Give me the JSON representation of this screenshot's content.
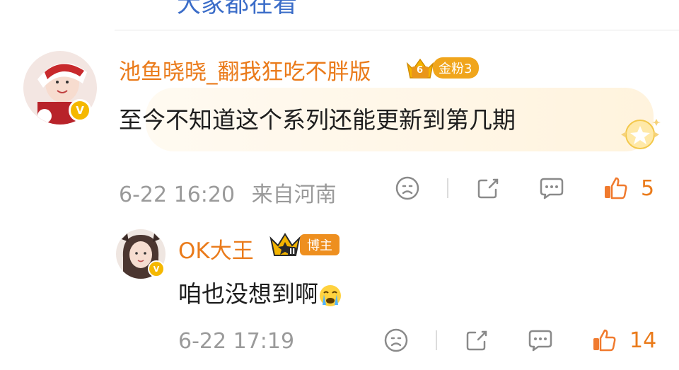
{
  "top_fragment": "大家都在看",
  "colors": {
    "accent": "#ea7b1b",
    "gold": "#f0a51c",
    "meta_gray": "#9a9a9a"
  },
  "comment": {
    "username": "池鱼晓晓_翻我狂吃不胖版",
    "fan_badge": {
      "level_icon": "6",
      "label": "金粉3"
    },
    "text": "至今不知道这个系列还能更新到第几期",
    "date": "6-22 16:20",
    "location": "来自河南",
    "likes": "5"
  },
  "reply": {
    "username": "OK大王",
    "badge": {
      "level_icon": "II",
      "label": "博主"
    },
    "text": "咱也没想到啊",
    "emoji": "crying-face-emoji",
    "date": "6-22 17:19",
    "likes": "14"
  },
  "icons": [
    "sad-face-icon",
    "share-icon",
    "comment-icon",
    "like-icon",
    "verified-icon",
    "crown-icon",
    "star-medal-icon"
  ]
}
